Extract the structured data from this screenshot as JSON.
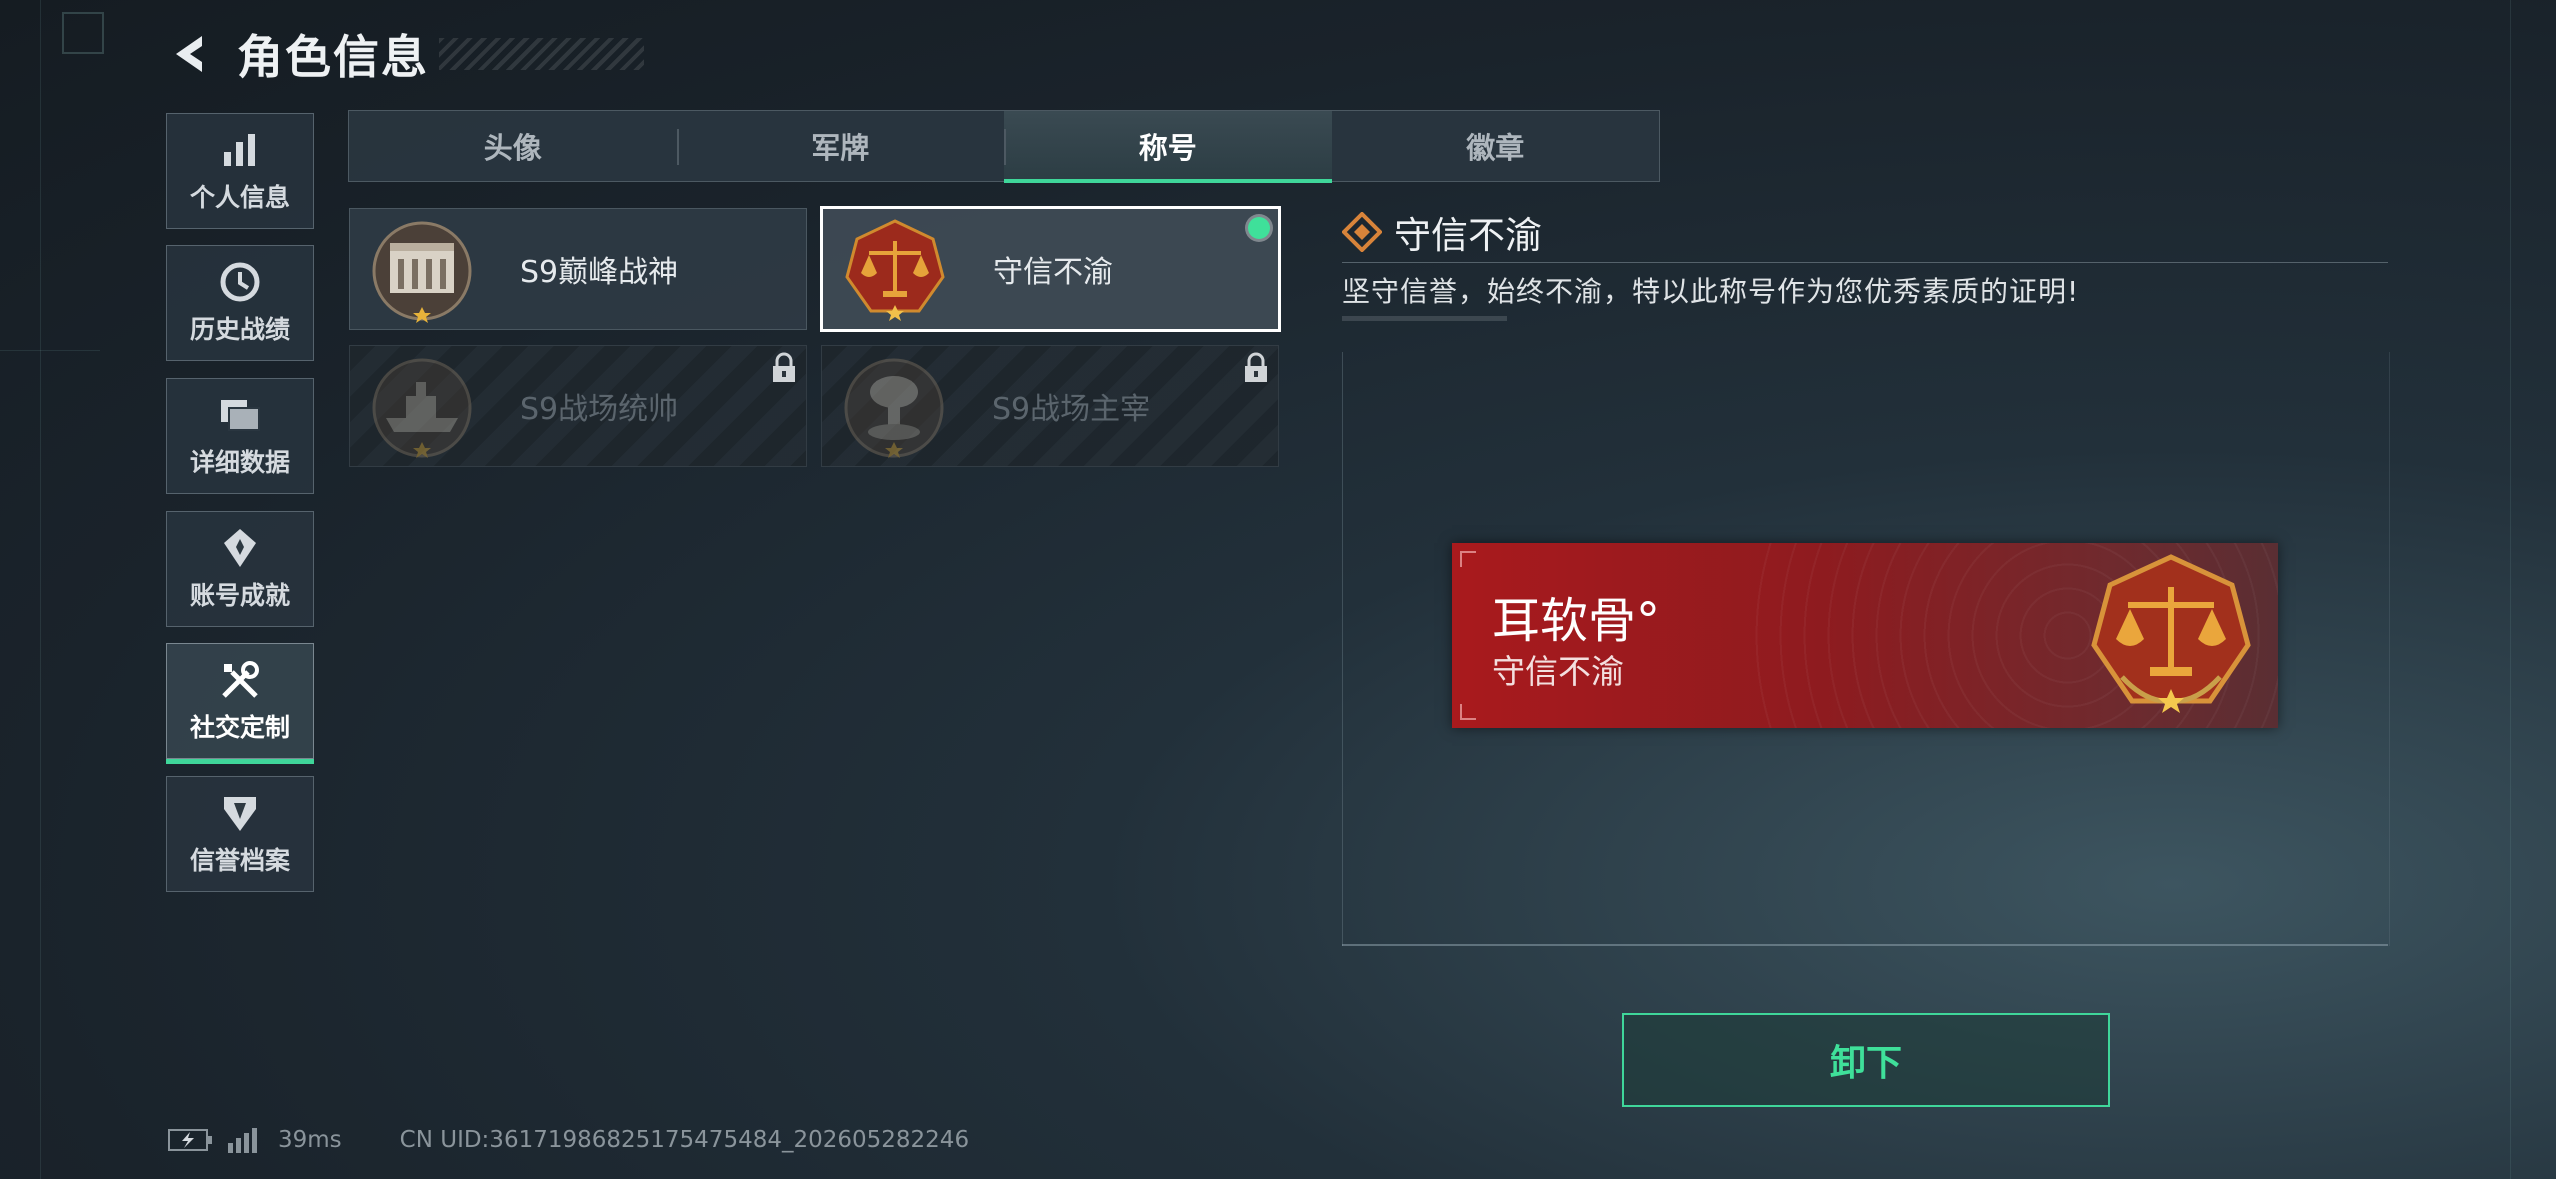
{
  "header": {
    "title": "角色信息",
    "back_icon": "back-arrow-icon"
  },
  "sidebar": {
    "items": [
      {
        "label": "个人信息",
        "icon": "bar-chart-icon",
        "active": false
      },
      {
        "label": "历史战绩",
        "icon": "clock-icon",
        "active": false
      },
      {
        "label": "详细数据",
        "icon": "folder-icon",
        "active": false
      },
      {
        "label": "账号成就",
        "icon": "medal-icon",
        "active": false
      },
      {
        "label": "社交定制",
        "icon": "tools-icon",
        "active": true
      },
      {
        "label": "信誉档案",
        "icon": "shield-icon",
        "active": false
      }
    ]
  },
  "tabs": [
    {
      "label": "头像",
      "active": false
    },
    {
      "label": "军牌",
      "active": false
    },
    {
      "label": "称号",
      "active": true
    },
    {
      "label": "徽章",
      "active": false
    }
  ],
  "titles": [
    {
      "name": "S9巅峰战神",
      "emblem": "building-emblem-icon",
      "locked": false,
      "selected": false
    },
    {
      "name": "守信不渝",
      "emblem": "scales-emblem-icon",
      "locked": false,
      "selected": true,
      "equipped": true
    },
    {
      "name": "S9战场统帅",
      "emblem": "ship-emblem-icon",
      "locked": true,
      "selected": false
    },
    {
      "name": "S9战场主宰",
      "emblem": "explosion-emblem-icon",
      "locked": true,
      "selected": false
    }
  ],
  "detail": {
    "title": "守信不渝",
    "description": "坚守信誉，始终不渝，特以此称号作为您优秀素质的证明!"
  },
  "nameplate": {
    "player_name": "耳软骨°",
    "title": "守信不渝"
  },
  "actions": {
    "unequip_label": "卸下"
  },
  "status": {
    "ping": "39ms",
    "uid": "CN UID:3617198682517547548​4_202605282246"
  },
  "colors": {
    "accent": "#3fd69a",
    "nameplate_red": "#a91a1d",
    "background": "#1d262e"
  }
}
